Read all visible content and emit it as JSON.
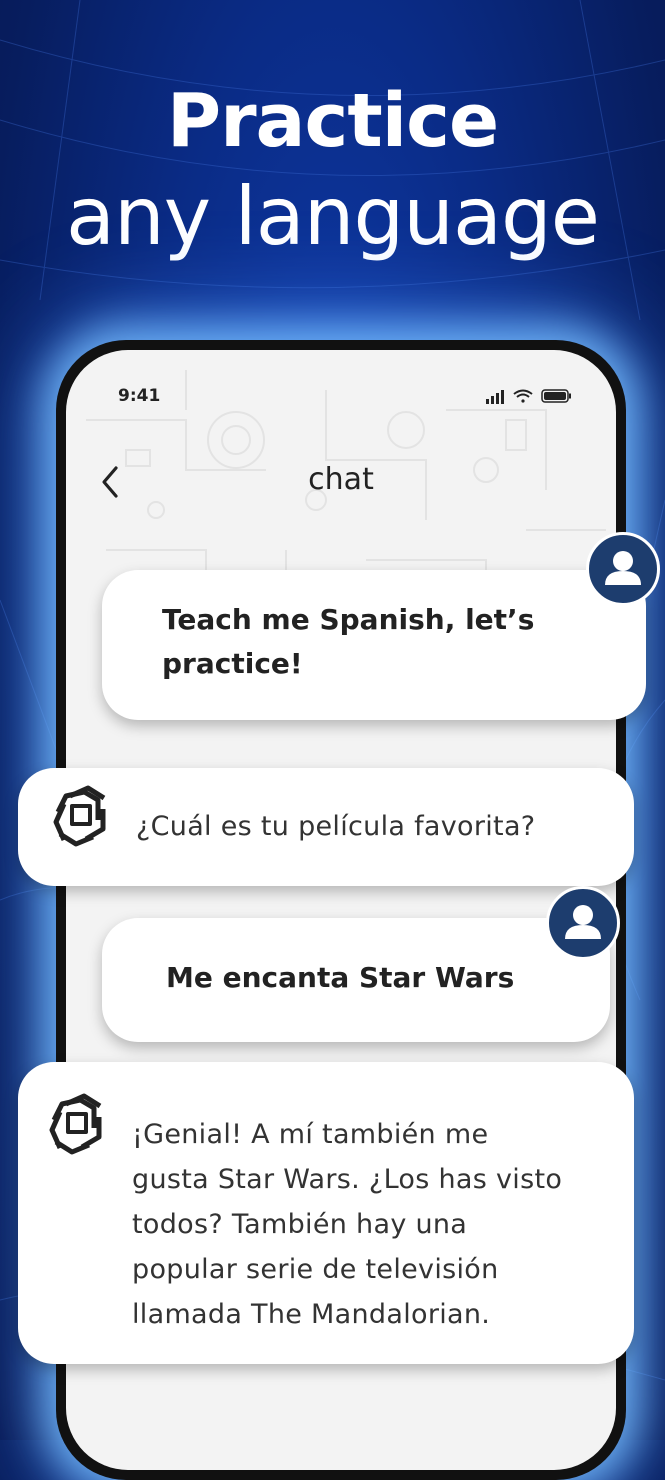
{
  "headline": {
    "line1": "Practice",
    "line2": "any language"
  },
  "status_bar": {
    "time": "9:41",
    "icons": [
      "signal-icon",
      "wifi-icon",
      "battery-icon"
    ]
  },
  "nav": {
    "back_icon": "chevron-left-icon",
    "title": "chat"
  },
  "messages": [
    {
      "role": "user",
      "lines": [
        "Teach me Spanish, let’s",
        "practice!"
      ]
    },
    {
      "role": "assistant",
      "lines": [
        "¿Cuál es tu película favorita?"
      ]
    },
    {
      "role": "user",
      "lines": [
        "Me encanta Star Wars"
      ]
    },
    {
      "role": "assistant",
      "lines": [
        "¡Genial! A mí también me",
        "gusta Star Wars. ¿Los has visto",
        "todos? También hay una",
        "popular serie de televisión",
        "llamada The Mandalorian."
      ]
    }
  ],
  "colors": {
    "background": "#0a2b85",
    "avatar": "#1d3d6e",
    "glow": "#78beff"
  }
}
